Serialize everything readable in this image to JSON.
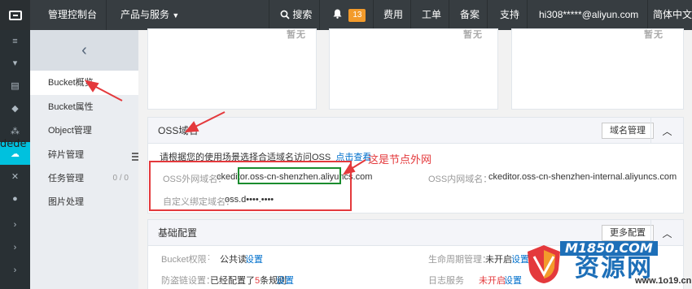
{
  "topbar": {
    "console": "管理控制台",
    "products": "产品与服务",
    "search": "搜索",
    "notifications": "13",
    "billing": "费用",
    "tickets": "工单",
    "icp": "备案",
    "support": "支持",
    "account": "hi308*****@aliyun.com",
    "language": "简体中文"
  },
  "sidenav": {
    "items": [
      {
        "label": "Bucket概览"
      },
      {
        "label": "Bucket属性"
      },
      {
        "label": "Object管理"
      },
      {
        "label": "碎片管理"
      },
      {
        "label": "任务管理",
        "count": "0 / 0"
      },
      {
        "label": "图片处理"
      }
    ]
  },
  "top_cards": {
    "label1": "暂无",
    "label2": "暂无",
    "label3": "暂无"
  },
  "oss_domain": {
    "title": "OSS域名",
    "manage_button": "域名管理",
    "hint": "请根据您的使用场景选择合适域名访问OSS",
    "hint_link": "点击查看",
    "external_label": "OSS外网域名：",
    "external_prefix": "ckeditor.",
    "external_value": "oss-cn-shenzhen.aliyuncs.com",
    "internal_label": "OSS内网域名：",
    "internal_value": "ckeditor.oss-cn-shenzhen-internal.aliyuncs.com",
    "custom_label": "自定义绑定域名：",
    "custom_value": "oss.d••••.••••"
  },
  "annotation": {
    "text": "这是节点外网"
  },
  "basic_config": {
    "title": "基础配置",
    "more_button": "更多配置",
    "rows": [
      {
        "label": "Bucket权限",
        "value": "公共读",
        "action": "设置"
      },
      {
        "label": "生命周期管理：",
        "value": "未开启",
        "action": "设置"
      },
      {
        "label": "防盗链设置：",
        "value_prefix": "已经配置了",
        "value_num": "5",
        "value_suffix": "条规则",
        "action": "设置"
      },
      {
        "label": "日志服务",
        "value": "未开启",
        "action": "设置"
      }
    ]
  },
  "watermark": {
    "site": "M1850.COM",
    "brand": "资源网",
    "url": "www.1o19.cn"
  },
  "overlay": {
    "dede": "dede"
  },
  "colors": {
    "topbar": "#373d41",
    "accent": "#00c1de",
    "link": "#0070cc",
    "red": "#e4393c",
    "green": "#1a8c2e"
  }
}
